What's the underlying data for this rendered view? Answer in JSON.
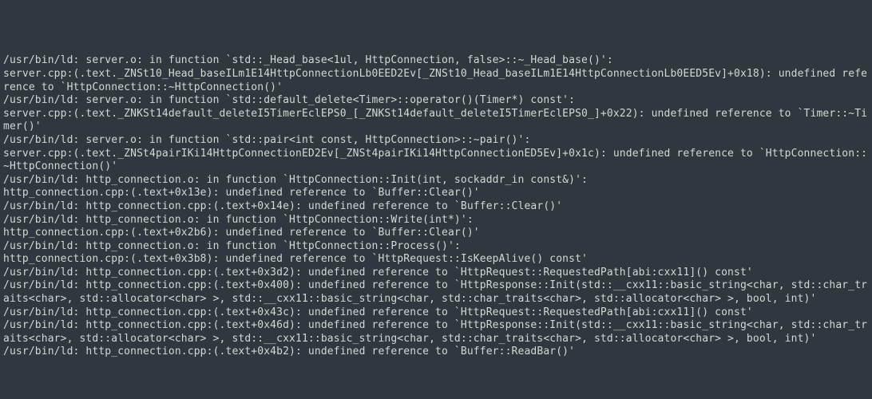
{
  "terminal": {
    "lines": [
      "/usr/bin/ld: server.o: in function `std::_Head_base<1ul, HttpConnection, false>::~_Head_base()':",
      "server.cpp:(.text._ZNSt10_Head_baseILm1E14HttpConnectionLb0EED2Ev[_ZNSt10_Head_baseILm1E14HttpConnectionLb0EED5Ev]+0x18): undefined reference to `HttpConnection::~HttpConnection()'",
      "/usr/bin/ld: server.o: in function `std::default_delete<Timer>::operator()(Timer*) const':",
      "server.cpp:(.text._ZNKSt14default_deleteI5TimerEclEPS0_[_ZNKSt14default_deleteI5TimerEclEPS0_]+0x22): undefined reference to `Timer::~Timer()'",
      "/usr/bin/ld: server.o: in function `std::pair<int const, HttpConnection>::~pair()':",
      "server.cpp:(.text._ZNSt4pairIKi14HttpConnectionED2Ev[_ZNSt4pairIKi14HttpConnectionED5Ev]+0x1c): undefined reference to `HttpConnection::~HttpConnection()'",
      "/usr/bin/ld: http_connection.o: in function `HttpConnection::Init(int, sockaddr_in const&)':",
      "http_connection.cpp:(.text+0x13e): undefined reference to `Buffer::Clear()'",
      "/usr/bin/ld: http_connection.cpp:(.text+0x14e): undefined reference to `Buffer::Clear()'",
      "/usr/bin/ld: http_connection.o: in function `HttpConnection::Write(int*)':",
      "http_connection.cpp:(.text+0x2b6): undefined reference to `Buffer::Clear()'",
      "/usr/bin/ld: http_connection.o: in function `HttpConnection::Process()':",
      "http_connection.cpp:(.text+0x3b8): undefined reference to `HttpRequest::IsKeepAlive() const'",
      "/usr/bin/ld: http_connection.cpp:(.text+0x3d2): undefined reference to `HttpRequest::RequestedPath[abi:cxx11]() const'",
      "/usr/bin/ld: http_connection.cpp:(.text+0x400): undefined reference to `HttpResponse::Init(std::__cxx11::basic_string<char, std::char_traits<char>, std::allocator<char> >, std::__cxx11::basic_string<char, std::char_traits<char>, std::allocator<char> >, bool, int)'",
      "/usr/bin/ld: http_connection.cpp:(.text+0x43c): undefined reference to `HttpRequest::RequestedPath[abi:cxx11]() const'",
      "/usr/bin/ld: http_connection.cpp:(.text+0x46d): undefined reference to `HttpResponse::Init(std::__cxx11::basic_string<char, std::char_traits<char>, std::allocator<char> >, std::__cxx11::basic_string<char, std::char_traits<char>, std::allocator<char> >, bool, int)'",
      "/usr/bin/ld: http_connection.cpp:(.text+0x4b2): undefined reference to `Buffer::ReadBar()'"
    ]
  }
}
